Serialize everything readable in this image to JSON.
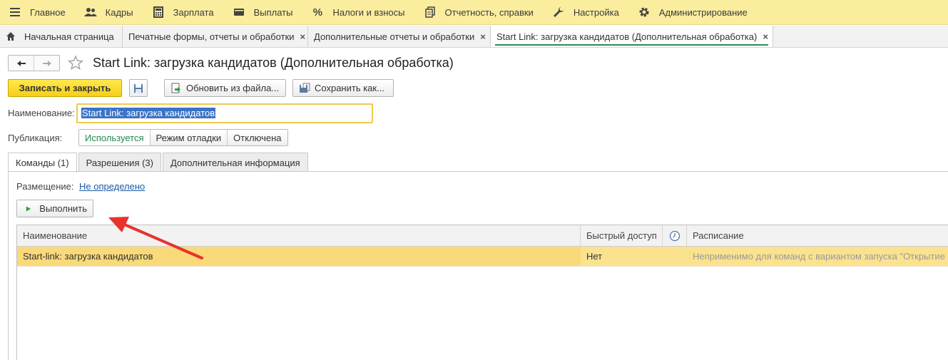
{
  "menu": [
    {
      "label": "Главное",
      "icon": "hamburger-icon"
    },
    {
      "label": "Кадры",
      "icon": "people-icon"
    },
    {
      "label": "Зарплата",
      "icon": "calculator-icon"
    },
    {
      "label": "Выплаты",
      "icon": "wallet-icon"
    },
    {
      "label": "Налоги и взносы",
      "icon": "percent-icon"
    },
    {
      "label": "Отчетность, справки",
      "icon": "documents-icon"
    },
    {
      "label": "Настройка",
      "icon": "wrench-icon"
    },
    {
      "label": "Администрирование",
      "icon": "gear-icon"
    }
  ],
  "open_tabs": [
    {
      "label": "Начальная страница"
    },
    {
      "label": "Печатные формы, отчеты и обработки"
    },
    {
      "label": "Дополнительные отчеты и обработки"
    },
    {
      "label": "Start Link: загрузка кандидатов (Дополнительная обработка)"
    }
  ],
  "close_glyph": "×",
  "title": "Start Link: загрузка кандидатов (Дополнительная обработка)",
  "toolbar": {
    "save_close": "Записать и закрыть",
    "update_from_file": "Обновить из файла...",
    "save_as": "Сохранить как..."
  },
  "form": {
    "name_label": "Наименование:",
    "name_value": "Start Link: загрузка кандидатов",
    "publication_label": "Публикация:",
    "publication_options": [
      "Используется",
      "Режим отладки",
      "Отключена"
    ],
    "publication_selected": "Используется"
  },
  "form_tabs": [
    "Команды (1)",
    "Разрешения (3)",
    "Дополнительная информация"
  ],
  "placement": {
    "label": "Размещение:",
    "value": "Не определено"
  },
  "run_button": "Выполнить",
  "table": {
    "headers": [
      "Наименование",
      "Быстрый доступ",
      "",
      "Расписание"
    ],
    "rows": [
      {
        "name": "Start-link: загрузка кандидатов",
        "quick_access": "Нет",
        "schedule": "Неприменимо для команд с вариантом запуска \"Открытие ф"
      }
    ]
  },
  "colors": {
    "menubar": "#fbed9e",
    "primary_button": "#f5cf16",
    "selected_row": "#fbe28f",
    "annotation_arrow": "#e8322c",
    "link": "#1a5aa6"
  }
}
